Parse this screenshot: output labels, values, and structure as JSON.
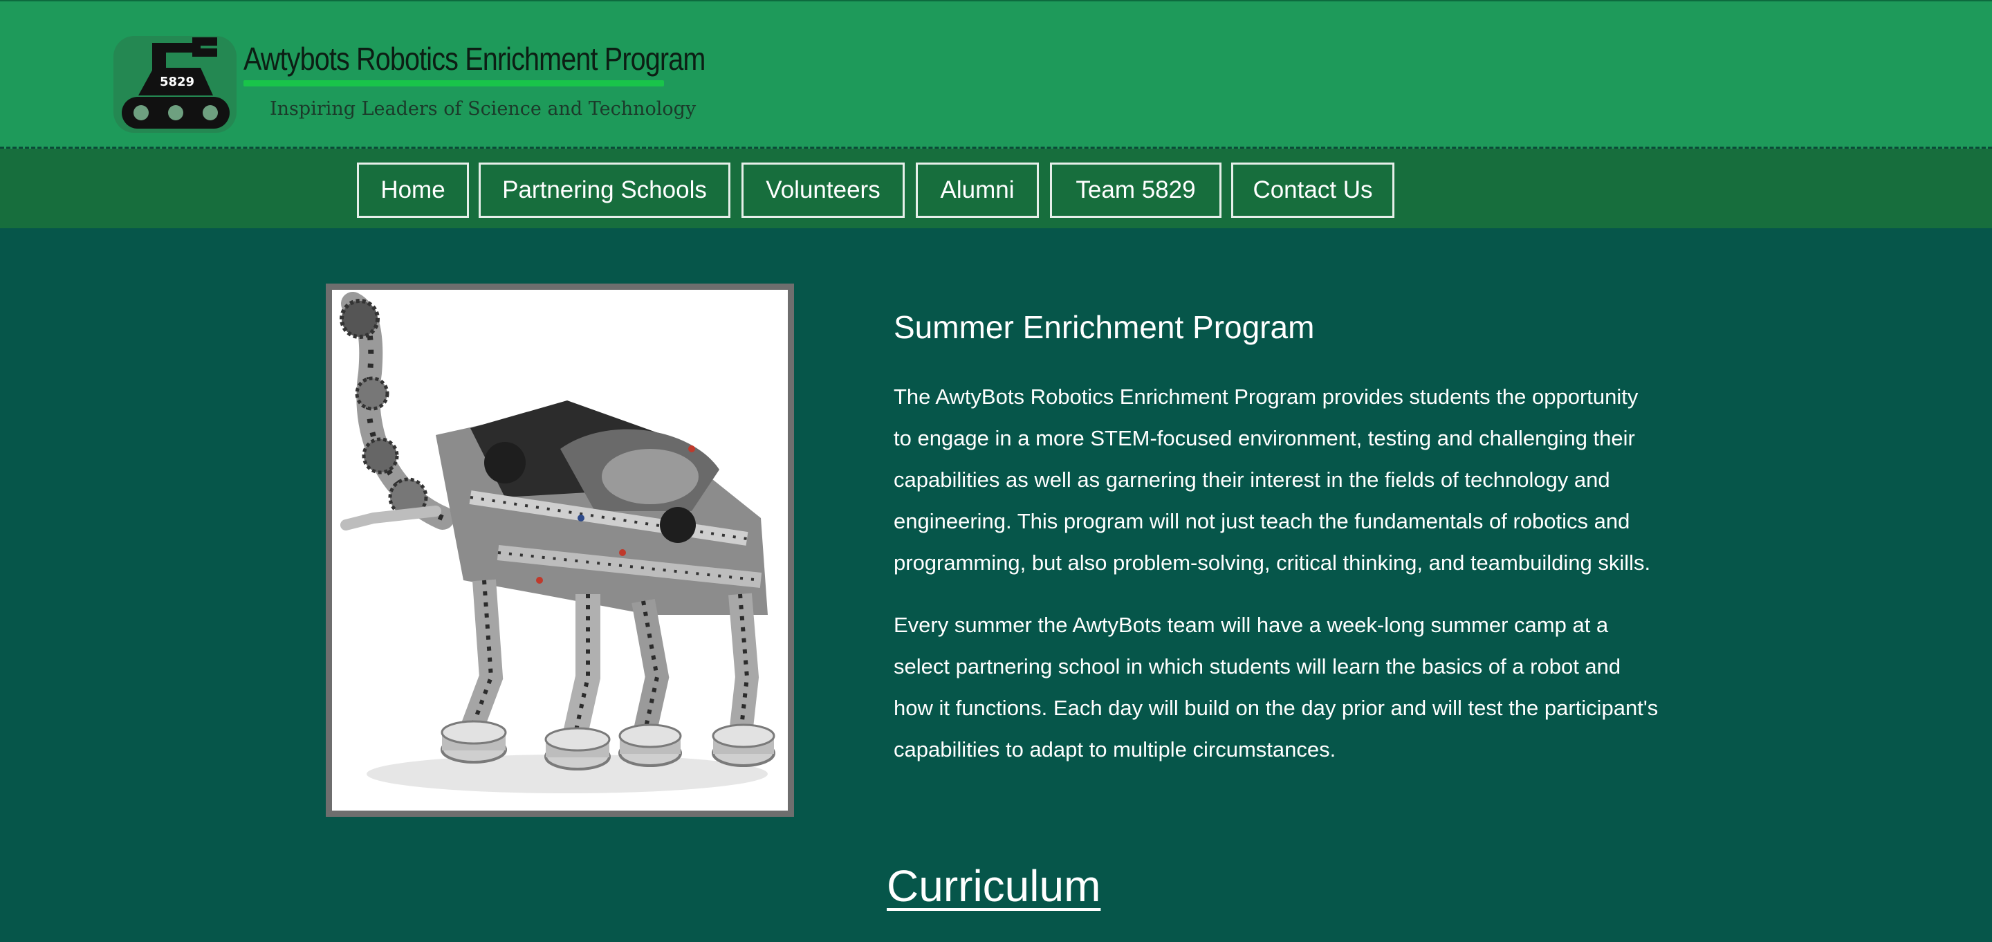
{
  "header": {
    "logo_badge": "5829",
    "title": "Awtybots Robotics Enrichment Program",
    "tagline": "Inspiring Leaders of Science and Technology"
  },
  "nav": {
    "items": [
      {
        "label": "Home"
      },
      {
        "label": "Partnering Schools"
      },
      {
        "label": "Volunteers"
      },
      {
        "label": "Alumni"
      },
      {
        "label": "Team 5829"
      },
      {
        "label": "Contact Us"
      }
    ]
  },
  "main": {
    "heading": "Summer Enrichment Program",
    "paragraph1_lines": [
      "The AwtyBots Robotics Enrichment Program provides students the opportunity",
      "to engage in a more STEM-focused environment, testing and challenging their",
      "capabilities as well as garnering their interest in the fields of technology and",
      "engineering. This program will not just teach the fundamentals of robotics and",
      "programming, but also problem-solving, critical thinking, and teambuilding skills."
    ],
    "paragraph2_lines": [
      "Every summer the AwtyBots team will have a week-long summer camp at a",
      "select partnering school in which students will learn the basics of a robot and",
      "how it functions. Each day will build on the day prior and will test the participant's",
      "capabilities to adapt to multiple circumstances."
    ],
    "image_icon": "lego-robot-elephant-image",
    "curriculum_heading": "Curriculum"
  },
  "colors": {
    "header_bg": "#1e9a5a",
    "nav_bg": "#176e3d",
    "page_bg": "#06564a",
    "accent_underline": "#19c44a"
  }
}
